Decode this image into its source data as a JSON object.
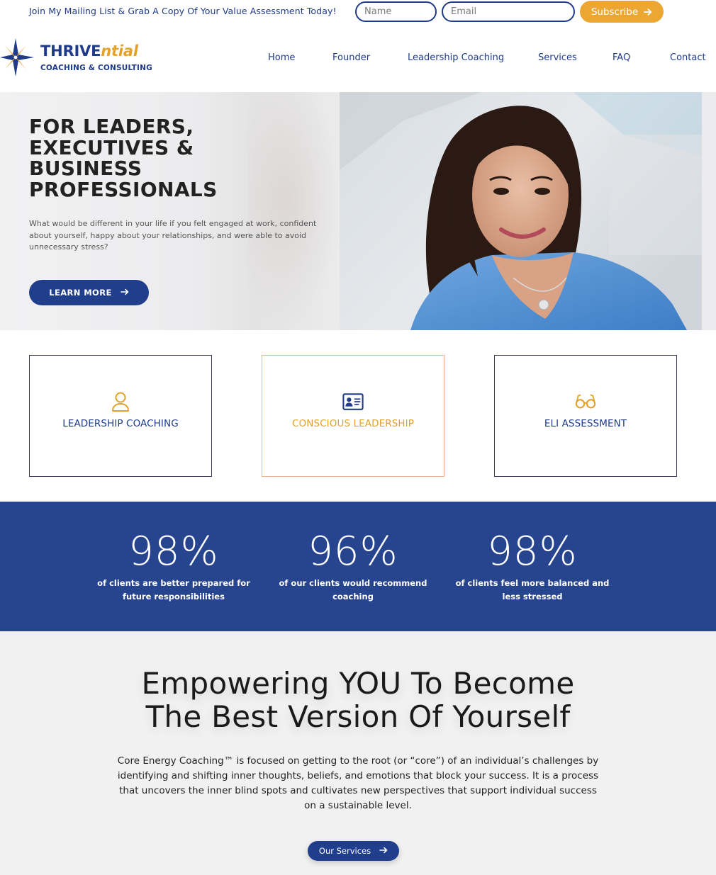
{
  "topbar": {
    "promo_text": "Join My Mailing List & Grab A Copy Of Your Value Assessment Today!",
    "name_placeholder": "Name",
    "email_placeholder": "Email",
    "subscribe_label": "Subscribe"
  },
  "logo": {
    "wordmark_main": "THRIVE",
    "wordmark_accent": "ntial",
    "tagline": "COACHING & CONSULTING"
  },
  "nav": {
    "items": [
      "Home",
      "Founder",
      "Leadership Coaching",
      "Services",
      "FAQ",
      "Contact"
    ]
  },
  "hero": {
    "heading": "FOR LEADERS, EXECUTIVES & BUSINESS PROFESSIONALS",
    "body": "What would be different in your life if you felt engaged at work, confident about yourself, happy about your relationships, and were able to avoid unnecessary stress?",
    "cta_label": "LEARN MORE"
  },
  "cards": [
    {
      "label": "LEADERSHIP COACHING",
      "icon": "user-icon"
    },
    {
      "label": "CONSCIOUS LEADERSHIP",
      "icon": "id-card-icon"
    },
    {
      "label": "ELI ASSESSMENT",
      "icon": "glasses-icon"
    }
  ],
  "stats": [
    {
      "value": "98%",
      "caption": "of clients are better prepared for future responsibilities"
    },
    {
      "value": "96%",
      "caption": "of our clients would recommend coaching"
    },
    {
      "value": "98%",
      "caption": "of clients feel more balanced and less stressed"
    }
  ],
  "empower": {
    "heading_line1": "Empowering YOU To Become",
    "heading_line2": "The Best Version Of Yourself",
    "body": "Core Energy Coaching™ is focused on getting to the root (or “core”) of an individual’s challenges by identifying and shifting inner thoughts, beliefs, and emotions that block your success. It is a process that uncovers the inner blind spots and cultivates new perspectives that support individual success on a sustainable level.",
    "cta_label": "Our Services"
  },
  "colors": {
    "brand_blue": "#213e8c",
    "brand_gold": "#eba731",
    "stats_band": "#27448f"
  }
}
